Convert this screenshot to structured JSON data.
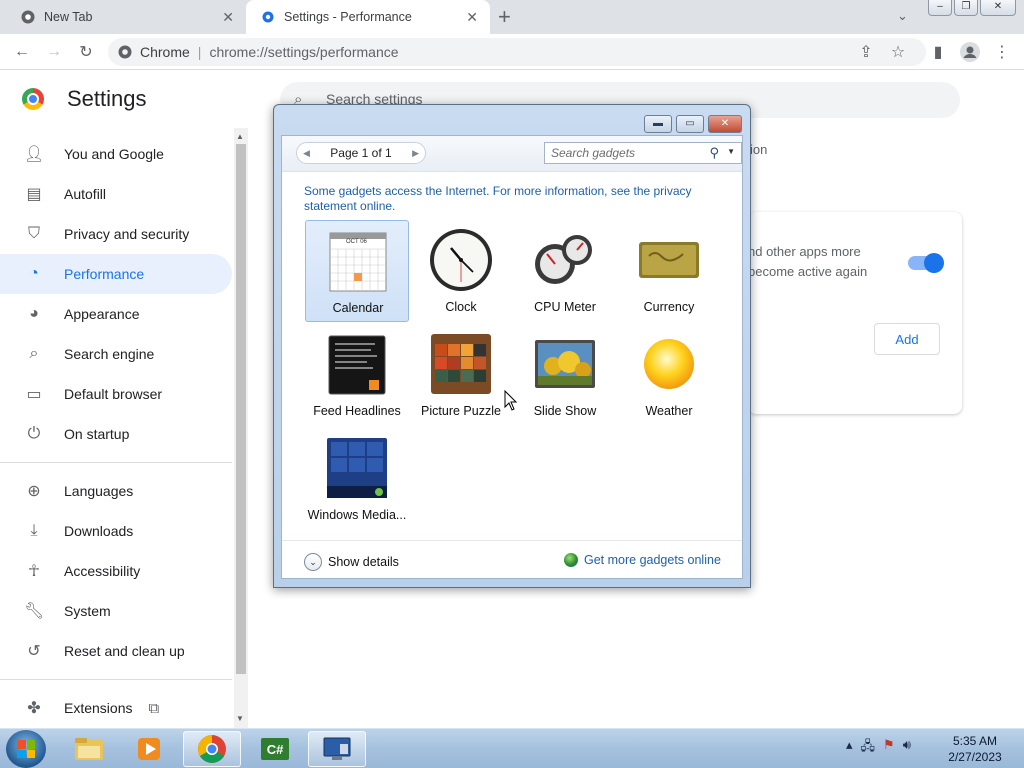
{
  "browser": {
    "tabs": [
      {
        "title": "New Tab",
        "active": false
      },
      {
        "title": "Settings - Performance",
        "active": true
      }
    ],
    "omnibox": {
      "site": "Chrome",
      "url": "chrome://settings/performance"
    }
  },
  "settings": {
    "title": "Settings",
    "search_placeholder": "Search settings",
    "nav": [
      {
        "label": "You and Google",
        "icon": "person-icon"
      },
      {
        "label": "Autofill",
        "icon": "clipboard-icon"
      },
      {
        "label": "Privacy and security",
        "icon": "shield-icon"
      },
      {
        "label": "Performance",
        "icon": "speedometer-icon",
        "active": true
      },
      {
        "label": "Appearance",
        "icon": "palette-icon"
      },
      {
        "label": "Search engine",
        "icon": "search-icon"
      },
      {
        "label": "Default browser",
        "icon": "browser-icon"
      },
      {
        "label": "On startup",
        "icon": "power-icon"
      },
      {
        "label": "Languages",
        "icon": "globe-icon"
      },
      {
        "label": "Downloads",
        "icon": "download-icon"
      },
      {
        "label": "Accessibility",
        "icon": "accessibility-icon"
      },
      {
        "label": "System",
        "icon": "wrench-icon"
      },
      {
        "label": "Reset and clean up",
        "icon": "history-icon"
      },
      {
        "label": "Extensions",
        "icon": "puzzle-icon"
      }
    ],
    "behind_dialog": {
      "partial_heading": "ion",
      "card_line1": "nd other apps more",
      "card_line2": "become active again",
      "add_button": "Add",
      "toggle_on": true
    }
  },
  "gadget_window": {
    "page_label": "Page 1 of 1",
    "search_placeholder": "Search gadgets",
    "notice": "Some gadgets access the Internet.  For more information, see the privacy statement online.",
    "gadgets": [
      {
        "label": "Calendar",
        "selected": true
      },
      {
        "label": "Clock"
      },
      {
        "label": "CPU Meter"
      },
      {
        "label": "Currency"
      },
      {
        "label": "Feed Headlines"
      },
      {
        "label": "Picture Puzzle"
      },
      {
        "label": "Slide Show"
      },
      {
        "label": "Weather"
      },
      {
        "label": "Windows Media..."
      }
    ],
    "calendar_month": "OCT 06",
    "show_details": "Show details",
    "get_more": "Get more gadgets online"
  },
  "taskbar": {
    "time": "5:35 AM",
    "date": "2/27/2023",
    "apps": [
      "file-explorer-icon",
      "media-player-icon",
      "chrome-icon",
      "csharp-icon",
      "gadgets-icon"
    ]
  }
}
